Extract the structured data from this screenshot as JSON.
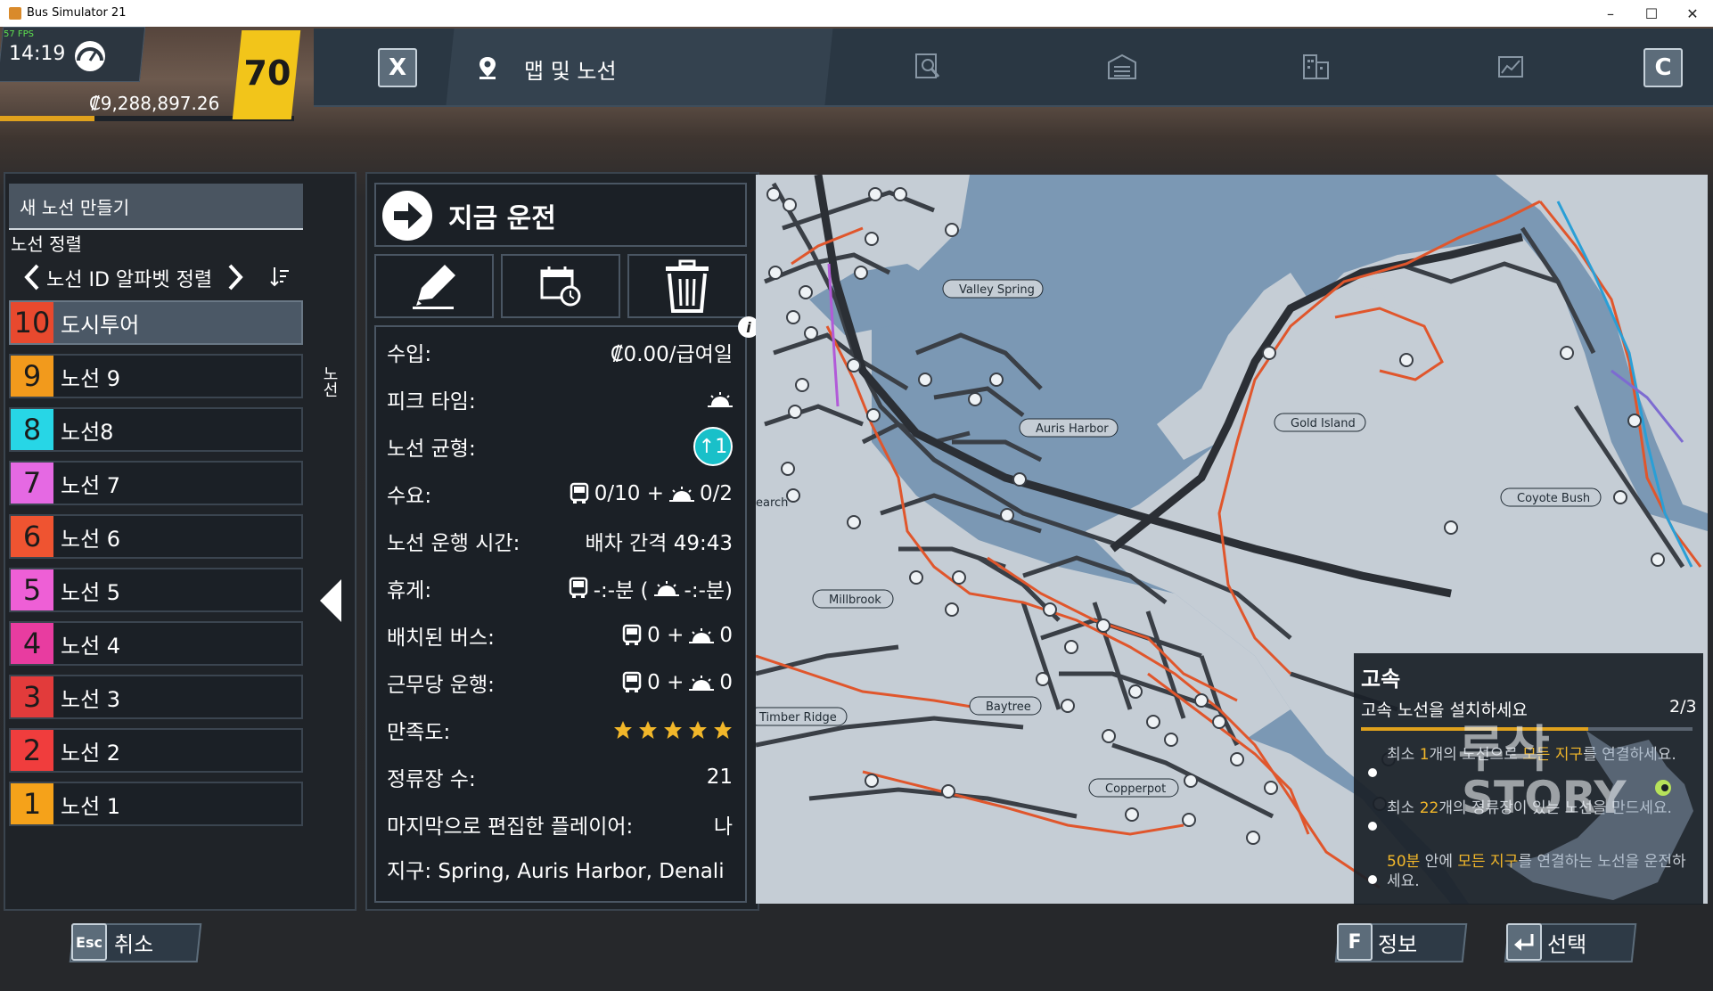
{
  "window": {
    "title": "Bus Simulator 21",
    "minimize": "–",
    "maximize": "☐",
    "close": "✕"
  },
  "hud": {
    "fps": "57 FPS",
    "clock": "14:19",
    "money": "₡9,288,897.26",
    "level": "70",
    "xp_fraction": 0.32
  },
  "toolbar": {
    "close_key": "X",
    "map_tab_label": "맵 및 노선",
    "right_key": "C",
    "icons": [
      "map-search-icon",
      "depot-icon",
      "buildings-icon",
      "stats-chart-icon"
    ]
  },
  "left": {
    "new_route": "새 노선 만들기",
    "sort_title": "노선 정렬",
    "sort_value": "노선 ID 알파벳 정렬",
    "side_label": "노선",
    "routes": [
      {
        "num": "10",
        "name": "도시투어",
        "color": "#e8492e",
        "selected": true
      },
      {
        "num": "9",
        "name": "노선 9",
        "color": "#f29a1c"
      },
      {
        "num": "8",
        "name": "노선8",
        "color": "#27d6e6"
      },
      {
        "num": "7",
        "name": "노선 7",
        "color": "#e569e3"
      },
      {
        "num": "6",
        "name": "노선 6",
        "color": "#ef5431"
      },
      {
        "num": "5",
        "name": "노선 5",
        "color": "#ee5fd6"
      },
      {
        "num": "4",
        "name": "노선 4",
        "color": "#e83ca0"
      },
      {
        "num": "3",
        "name": "노선 3",
        "color": "#e23b3b"
      },
      {
        "num": "2",
        "name": "노선 2",
        "color": "#f03d3d"
      },
      {
        "num": "1",
        "name": "노선 1",
        "color": "#f5a21a"
      }
    ]
  },
  "middle": {
    "drive_now": "지금 운전",
    "actions": [
      "edit-pencil-icon",
      "schedule-calendar-icon",
      "delete-trash-icon"
    ],
    "stats": [
      {
        "label": "수입:",
        "value": "₡0.00/급여일"
      },
      {
        "label": "피크 타임:",
        "value": ""
      },
      {
        "label": "노선 균형:",
        "value": "↑1"
      },
      {
        "label": "수요:",
        "value": "0/10 + ",
        "value2": "0/2"
      },
      {
        "label": "노선 운행 시간:",
        "value": "배차 간격 49:43"
      },
      {
        "label": "휴게:",
        "value": "-:-분 (",
        "value2": "-:-분)"
      },
      {
        "label": "배치된 버스:",
        "value": "0 + ",
        "value2": "0"
      },
      {
        "label": "근무당 운행:",
        "value": "0 + ",
        "value2": "0"
      },
      {
        "label": "만족도:",
        "value": "",
        "rating": 5
      },
      {
        "label": "정류장 수:",
        "value": "21"
      },
      {
        "label": "마지막으로 편집한 플레이어:",
        "value": "나"
      }
    ],
    "district": "지구: Spring, Auris Harbor, Denali Re"
  },
  "map": {
    "labels": [
      "Valley Spring",
      "Auris Harbor",
      "Gold Island",
      "Coyote Bush",
      "Millbrook",
      "Baytree",
      "Timber Ridge",
      "Copperpot",
      "earch"
    ],
    "water_color": "#7c9ab5",
    "land_color": "#c3ccd5",
    "route_color": "#e0562c"
  },
  "quest": {
    "title": "고속",
    "subtitle": "고속 노선을 설치하세요",
    "progress": "2/3",
    "progress_fraction": 0.67,
    "items": [
      {
        "pre": "최소 ",
        "hl": "1",
        "mid": "개의 노선으로 ",
        "hl2": "모든 지구",
        "post": "를 연결하세요."
      },
      {
        "pre": "최소 ",
        "hl": "22",
        "mid": "개의 정류장이 있는 노선을 만드세요.",
        "hl2": "",
        "post": ""
      },
      {
        "pre": "",
        "hl": "50분",
        "mid": " 안에 ",
        "hl2": "모든 지구",
        "post": "를 연결하는 노선을 운전하세요."
      }
    ],
    "watermark_top": "루삭",
    "watermark_bottom": "STORY"
  },
  "bottom": {
    "esc_key": "Esc",
    "cancel": "취소",
    "info_key": "F",
    "info": "정보",
    "select": "선택"
  }
}
